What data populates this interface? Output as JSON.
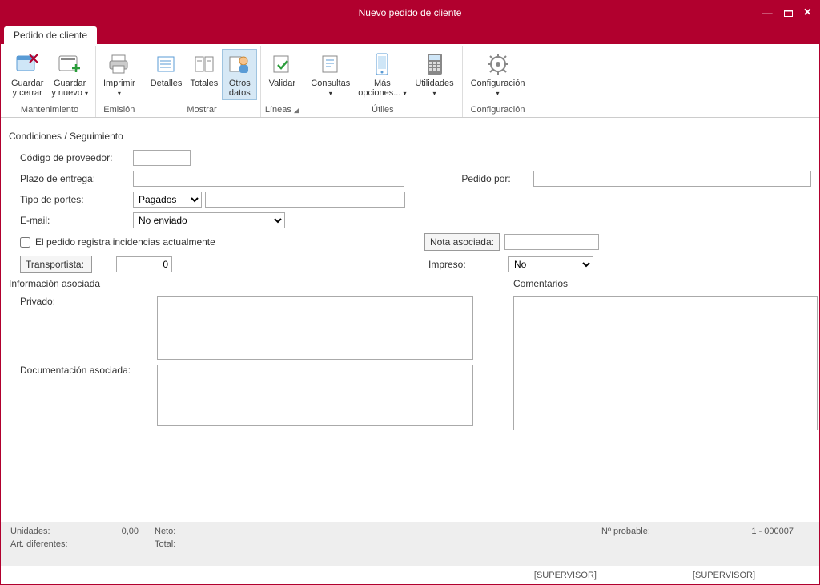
{
  "window": {
    "title": "Nuevo pedido de cliente"
  },
  "tabs": {
    "main": "Pedido de cliente"
  },
  "ribbon": {
    "mantenimiento": {
      "label": "Mantenimiento",
      "guardar_cerrar": "Guardar\ny cerrar",
      "guardar_nuevo": "Guardar\ny nuevo"
    },
    "emision": {
      "label": "Emisión",
      "imprimir": "Imprimir"
    },
    "mostrar": {
      "label": "Mostrar",
      "detalles": "Detalles",
      "totales": "Totales",
      "otros_datos": "Otros\ndatos"
    },
    "lineas": {
      "label": "Líneas",
      "validar": "Validar"
    },
    "utiles": {
      "label": "Útiles",
      "consultas": "Consultas",
      "mas_opciones": "Más\nopciones...",
      "utilidades": "Utilidades"
    },
    "configuracion": {
      "label": "Configuración",
      "configuracion": "Configuración"
    }
  },
  "form": {
    "section_condiciones": "Condiciones / Seguimiento",
    "codigo_proveedor": "Código de proveedor:",
    "plazo_entrega": "Plazo de entrega:",
    "pedido_por": "Pedido por:",
    "tipo_portes": "Tipo de portes:",
    "tipo_portes_value": "Pagados",
    "email": "E-mail:",
    "email_value": "No enviado",
    "incidencias": "El pedido registra incidencias actualmente",
    "nota_asociada": "Nota asociada:",
    "transportista": "Transportista:",
    "transportista_value": "0",
    "impreso": "Impreso:",
    "impreso_value": "No",
    "section_info": "Información asociada",
    "section_comentarios": "Comentarios",
    "privado": "Privado:",
    "doc_asociada": "Documentación asociada:"
  },
  "status": {
    "unidades_label": "Unidades:",
    "unidades_value": "0,00",
    "art_dif_label": "Art. diferentes:",
    "neto_label": "Neto:",
    "total_label": "Total:",
    "n_probable_label": "Nº probable:",
    "n_probable_value": "1 - 000007",
    "supervisor": "[SUPERVISOR]"
  }
}
